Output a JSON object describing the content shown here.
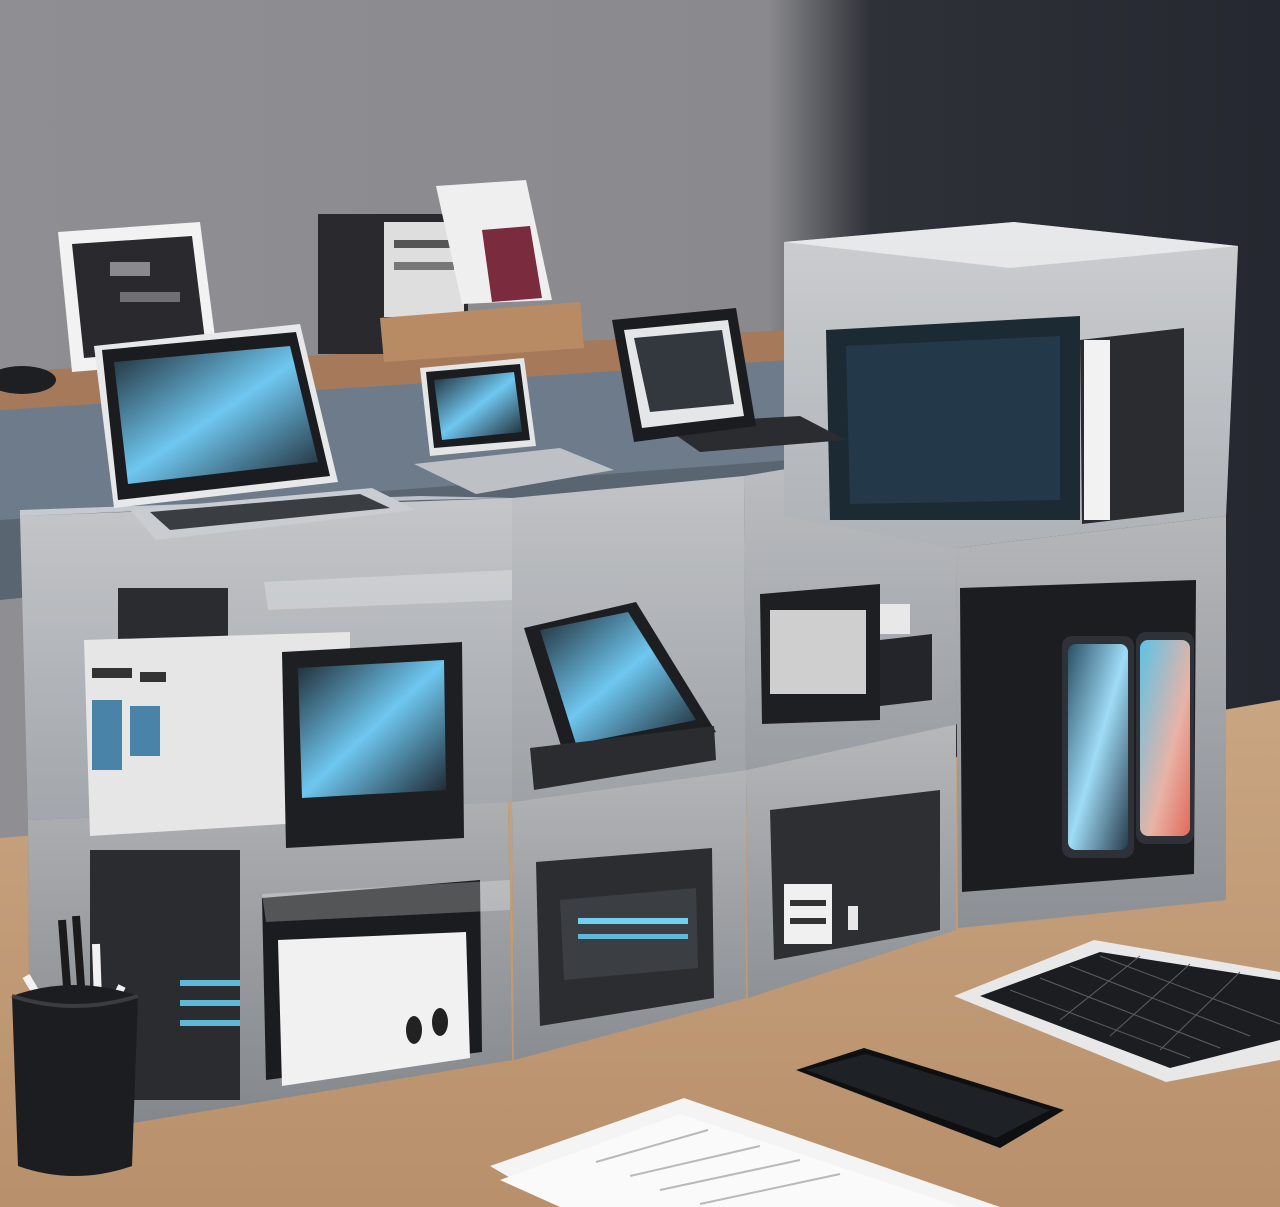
{
  "scene": {
    "kind": "photo-like illustration",
    "palette": {
      "wall": "#8b8b8f",
      "wall_dark": "#2b2f36",
      "desk": "#c7a07b",
      "shelf": "#a77a57",
      "box_tint": "#ffffff",
      "screen_glow": "#7fd3ff",
      "device_dark": "#1a1c20"
    }
  },
  "objects": [
    {
      "name": "acrylic-storage-box",
      "count": 7
    },
    {
      "name": "laptop",
      "count": 1
    },
    {
      "name": "mini-laptop",
      "count": 1
    },
    {
      "name": "tablet-on-stand",
      "count": 2
    },
    {
      "name": "smartphone",
      "count": 2
    },
    {
      "name": "pen-holder",
      "count": 1
    },
    {
      "name": "paper-document",
      "count": 1
    },
    {
      "name": "solar-panel-tablet",
      "count": 1
    },
    {
      "name": "picture-frame",
      "count": 3
    }
  ]
}
